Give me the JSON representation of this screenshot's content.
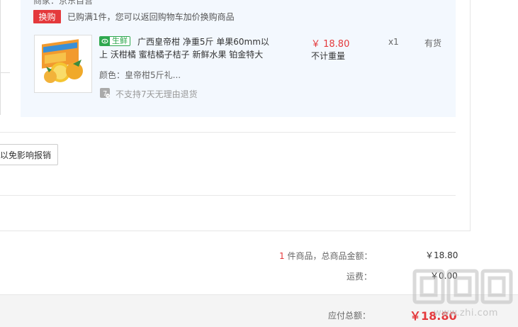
{
  "top_clip_text": "商家：京东自营",
  "swap": {
    "badge": "换购",
    "message": "已购满1件，您可以返回购物车加价换购商品"
  },
  "item": {
    "fresh_label": "生鲜",
    "title": "广西皇帝柑 净重5斤 单果60mm以上 沃柑橘 蜜桔橘子桔子 新鲜水果 铂金特大",
    "color": "颜色：皇帝柑5斤礼...",
    "no_return": "不支持7天无理由退货",
    "price": "￥ 18.80",
    "weight": "不计重量",
    "qty": "x1",
    "stock": "有货"
  },
  "remark_button": "以免影响报销",
  "summary": {
    "count_num": "1",
    "count_label": " 件商品，总商品金额：",
    "amount": "￥18.80",
    "shipping_label": "运费：",
    "shipping_amount": "￥0.00",
    "total_label": "应付总额：",
    "total_amount": "￥18.80"
  },
  "watermark": {
    "text": "www.zhi.com"
  },
  "colors": {
    "accent_red": "#e4393c",
    "fresh_green": "#2fa84f",
    "product_bg": "#f3f8fe"
  },
  "icons": [
    "fresh-icon",
    "no-return-icon",
    "orange-product-image"
  ]
}
